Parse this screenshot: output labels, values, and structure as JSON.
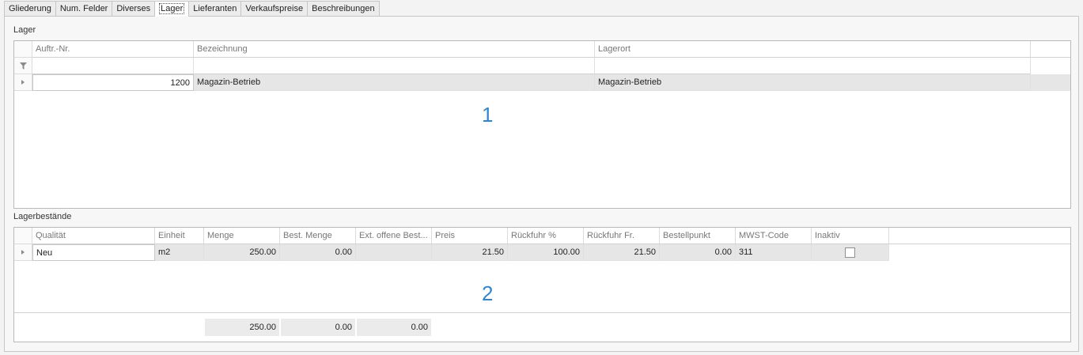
{
  "tabs": [
    {
      "label": "Gliederung"
    },
    {
      "label": "Num. Felder"
    },
    {
      "label": "Diverses"
    },
    {
      "label": "Lager"
    },
    {
      "label": "Lieferanten"
    },
    {
      "label": "Verkaufspreise"
    },
    {
      "label": "Beschreibungen"
    }
  ],
  "active_tab": "Lager",
  "lager": {
    "title": "Lager",
    "columns": [
      "Auftr.-Nr.",
      "Bezeichnung",
      "Lagerort"
    ],
    "rows": [
      {
        "auftr_nr": "1200",
        "bezeichnung": "Magazin-Betrieb",
        "lagerort": "Magazin-Betrieb"
      }
    ],
    "annotation": "1"
  },
  "bestaende": {
    "title": "Lagerbestände",
    "columns": [
      "Qualität",
      "Einheit",
      "Menge",
      "Best. Menge",
      "Ext. offene Best...",
      "Preis",
      "Rückfuhr %",
      "Rückfuhr Fr.",
      "Bestellpunkt",
      "MWST-Code",
      "Inaktiv"
    ],
    "rows": [
      {
        "qualitaet": "Neu",
        "einheit": "m2",
        "menge": "250.00",
        "best_menge": "0.00",
        "ext_offene": "",
        "preis": "21.50",
        "rueckfuhr_pct": "100.00",
        "rueckfuhr_fr": "21.50",
        "bestellpunkt": "0.00",
        "mwst_code": "311",
        "inaktiv": false
      }
    ],
    "totals": {
      "menge": "250.00",
      "best_menge": "0.00",
      "ext_offene": "0.00"
    },
    "annotation": "2"
  }
}
